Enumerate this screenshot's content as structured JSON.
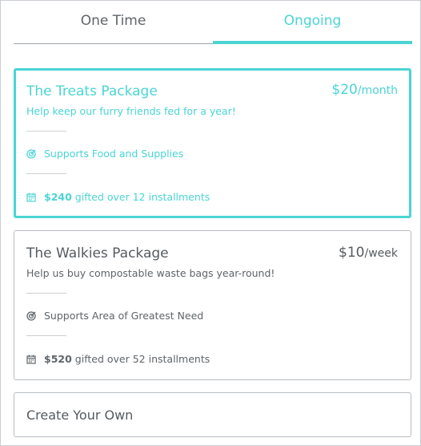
{
  "tabs": [
    {
      "label": "One Time"
    },
    {
      "label": "Ongoing"
    }
  ],
  "packages": [
    {
      "title": "The Treats Package",
      "price": "$20",
      "price_unit": "/month",
      "description": "Help keep our furry friends fed for a year!",
      "supports": "Supports Food and Supplies",
      "gift_amount": "$240",
      "gift_text": "gifted over 12 installments",
      "selected": true
    },
    {
      "title": "The Walkies Package",
      "price": "$10",
      "price_unit": "/week",
      "description": "Help us buy compostable waste bags year-round!",
      "supports": "Supports Area of Greatest Need",
      "gift_amount": "$520",
      "gift_text": "gifted over 52 installments",
      "selected": false
    }
  ],
  "create_own": {
    "label": "Create Your Own"
  },
  "colors": {
    "accent": "#4bd4d4",
    "text": "#555b61",
    "border": "#b9bec3"
  },
  "icons": {
    "supports": "target-icon",
    "installments": "calendar-icon"
  }
}
